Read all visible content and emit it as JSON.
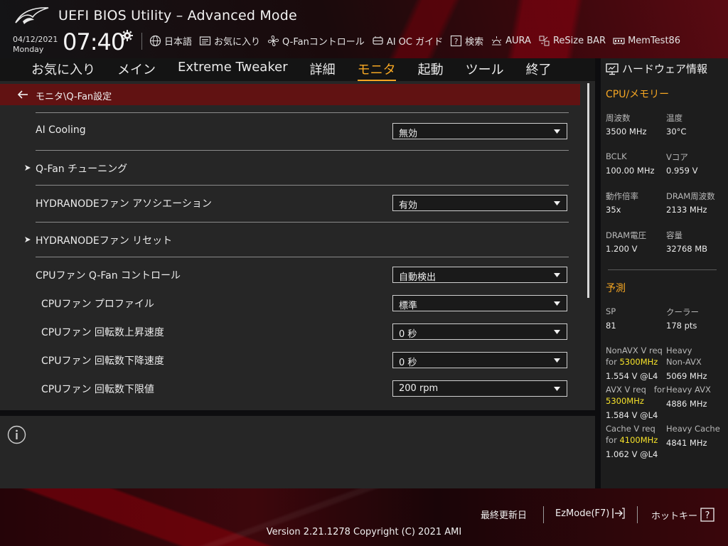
{
  "header": {
    "title": "UEFI BIOS Utility – Advanced Mode",
    "date": "04/12/2021",
    "day": "Monday",
    "time": "07:40"
  },
  "toolbar": {
    "items": [
      {
        "label": "日本語",
        "icon": "globe-icon"
      },
      {
        "label": "お気に入り",
        "icon": "favorites-icon"
      },
      {
        "label": "Q-Fanコントロール",
        "icon": "fan-icon"
      },
      {
        "label": "AI OC ガイド",
        "icon": "ai-oc-icon"
      },
      {
        "label": "検索",
        "icon": "search-help-icon"
      },
      {
        "label": "AURA",
        "icon": "aura-icon"
      },
      {
        "label": "ReSize BAR",
        "icon": "resize-bar-icon"
      },
      {
        "label": "MemTest86",
        "icon": "memtest-icon"
      }
    ]
  },
  "menu": {
    "items": [
      "お気に入り",
      "メイン",
      "Extreme Tweaker",
      "詳細",
      "モニタ",
      "起動",
      "ツール",
      "終了"
    ],
    "active_index": 4
  },
  "breadcrumb": "モニタ\\Q-Fan設定",
  "settings": {
    "ai_cooling": {
      "label": "AI Cooling",
      "value": "無効"
    },
    "qfan_tuning": {
      "label": "Q-Fan チューニング"
    },
    "hydranode_assoc": {
      "label": "HYDRANODEファン アソシエーション",
      "value": "有効"
    },
    "hydranode_reset": {
      "label": "HYDRANODEファン リセット"
    },
    "cpu_fan_control": {
      "label": "CPUファン Q-Fan コントロール",
      "value": "自動検出"
    },
    "cpu_fan_profile": {
      "label": "CPUファン プロファイル",
      "value": "標準"
    },
    "cpu_fan_step_up": {
      "label": "CPUファン 回転数上昇速度",
      "value": "0 秒"
    },
    "cpu_fan_step_down": {
      "label": "CPUファン 回転数下降速度",
      "value": "0 秒"
    },
    "cpu_fan_lower_limit": {
      "label": "CPUファン 回転数下限値",
      "value": "200 rpm"
    }
  },
  "hardware": {
    "title": "ハードウェア情報",
    "cpu_mem": {
      "heading": "CPU/メモリー",
      "freq_label": "周波数",
      "freq": "3500 MHz",
      "temp_label": "温度",
      "temp": "30°C",
      "bclk_label": "BCLK",
      "bclk": "100.00 MHz",
      "vcore_label": "Vコア",
      "vcore": "0.959 V",
      "ratio_label": "動作倍率",
      "ratio": "35x",
      "dram_freq_label": "DRAM周波数",
      "dram_freq": "2133 MHz",
      "dram_volt_label": "DRAM電圧",
      "dram_volt": "1.200 V",
      "capacity_label": "容量",
      "capacity": "32768 MB"
    },
    "prediction": {
      "heading": "予測",
      "sp_label": "SP",
      "sp": "81",
      "cooler_label": "クーラー",
      "cooler": "178 pts",
      "nonavx_req_label": "NonAVX V req",
      "nonavx_for": "for",
      "nonavx_freq": "5300MHz",
      "nonavx_v": "1.554 V @L4",
      "heavy_nonavx_label1": "Heavy",
      "heavy_nonavx_label2": "Non-AVX",
      "heavy_nonavx": "5069 MHz",
      "avx_req_label": "AVX V req",
      "avx_for": "for",
      "avx_freq": "5300MHz",
      "avx_v": "1.584 V @L4",
      "heavy_avx_label": "Heavy AVX",
      "heavy_avx": "4886 MHz",
      "cache_req_label": "Cache V req",
      "cache_for": "for",
      "cache_freq": "4100MHz",
      "cache_v": "1.062 V @L4",
      "heavy_cache_label": "Heavy Cache",
      "heavy_cache": "4841 MHz"
    }
  },
  "footer": {
    "last_modified": "最終更新日",
    "ezmode": "EzMode(F7)",
    "hotkeys": "ホットキー",
    "hotkey_glyph": "?",
    "version": "Version 2.21.1278 Copyright (C) 2021 AMI"
  },
  "colors": {
    "accent": "#f5a623",
    "breadcrumb_bg": "#611212",
    "highlight": "#f5e12a"
  }
}
